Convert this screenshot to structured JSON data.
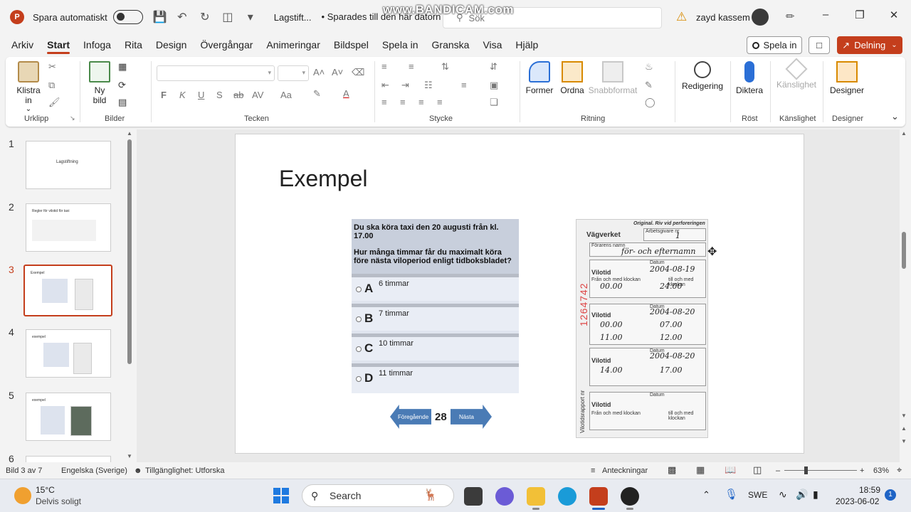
{
  "titlebar": {
    "app_logo": "P",
    "autosave_label": "Spara automatiskt",
    "doc_title": "Lagstift...",
    "saved_status": "• Sparades till den här datorn ⌄",
    "search_placeholder": "Sök",
    "watermark": "www.BANDICAM.com",
    "user_name": "zayd kassem"
  },
  "tabs": [
    "Arkiv",
    "Start",
    "Infoga",
    "Rita",
    "Design",
    "Övergångar",
    "Animeringar",
    "Bildspel",
    "Spela in",
    "Granska",
    "Visa",
    "Hjälp"
  ],
  "active_tab": "Start",
  "actions": {
    "record": "Spela in",
    "share": "Delning"
  },
  "ribbon": {
    "paste": "Klistra in",
    "paste_arrow": "⌄",
    "new_slide_line1": "Ny",
    "new_slide_line2": "bild",
    "shapes": "Former",
    "arrange": "Ordna",
    "quick_styles": "Snabbformat",
    "editing": "Redigering",
    "dictate": "Diktera",
    "sensitivity": "Känslighet",
    "designer": "Designer",
    "format_labels": {
      "bold": "F",
      "italic": "K",
      "underline": "U",
      "shadow": "S",
      "strike": "ab",
      "spacing": "AV",
      "case": "Aa"
    },
    "groups": [
      "Urklipp",
      "Bilder",
      "Tecken",
      "Stycke",
      "Ritning",
      "Röst",
      "Känslighet",
      "Designer"
    ]
  },
  "thumbnails": [
    {
      "num": "1",
      "title": "Lagstiftning"
    },
    {
      "num": "2",
      "title": "Regler för vilotid för taxi"
    },
    {
      "num": "3",
      "title": "Exempel"
    },
    {
      "num": "4",
      "title": "exempel"
    },
    {
      "num": "5",
      "title": "exempel"
    },
    {
      "num": "6",
      "title": ""
    }
  ],
  "slide": {
    "title": "Exempel",
    "question_line1": "Du ska köra taxi den 20 augusti från kl. 17.00",
    "question_line2": "Hur många timmar får du maximalt köra före nästa viloperiod enligt tidboksbladet?",
    "options": [
      {
        "letter": "A",
        "text": "6 timmar"
      },
      {
        "letter": "B",
        "text": "7 timmar"
      },
      {
        "letter": "C",
        "text": "10 timmar"
      },
      {
        "letter": "D",
        "text": "11 timmar"
      }
    ],
    "prev_label": "Föregående",
    "next_label": "Nästa",
    "page_number": "28"
  },
  "document": {
    "original": "Original. Riv vid perforeringen",
    "brand": "Vägverket",
    "sheet_label": "Arbetsgivare nr",
    "sheet_value": "1",
    "driver_label": "Förarens namn",
    "driver_value": "för- och efternamn",
    "vilotid": "Vilotid",
    "datum": "Datum",
    "from_label": "Från och med klockan",
    "to_label": "till och med klockan",
    "entries": [
      {
        "date": "2004-08-19",
        "from": "00.00",
        "to": "24.00"
      },
      {
        "date": "2004-08-20",
        "from": "00.00",
        "to": "07.00",
        "from2": "11.00",
        "to2": "12.00"
      },
      {
        "date": "2004-08-20",
        "from": "14.00",
        "to": "17.00"
      }
    ],
    "serial": "1264742",
    "side_label": "Vilotidsrapport nr"
  },
  "statusbar": {
    "slide_info": "Bild 3 av 7",
    "language": "Engelska (Sverige)",
    "accessibility": "Tillgänglighet: Utforska",
    "notes": "Anteckningar",
    "zoom": "63%"
  },
  "taskbar": {
    "temperature": "15°C",
    "weather": "Delvis soligt",
    "search": "Search",
    "language": "SWE",
    "time": "18:59",
    "date": "2023-06-02",
    "notifications": "1"
  },
  "colors": {
    "accent": "#c43e1c",
    "nav_arrow": "#4a7bb5"
  }
}
